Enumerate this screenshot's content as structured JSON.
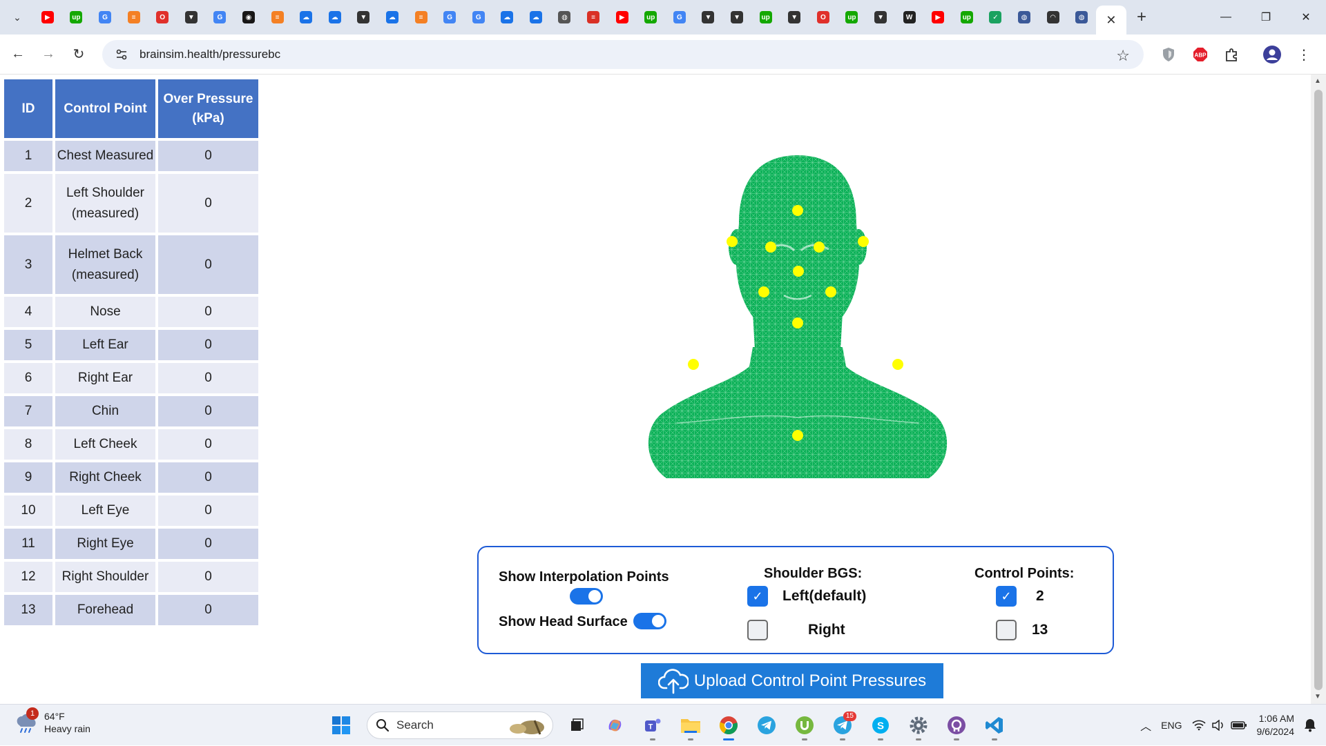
{
  "browser": {
    "tabs": [
      {
        "icon": "youtube-icon",
        "color": "#ff0000"
      },
      {
        "icon": "upwork-icon",
        "color": "#14a800"
      },
      {
        "icon": "google-icon",
        "color": "#4285f4"
      },
      {
        "icon": "stackoverflow-icon",
        "color": "#f48024"
      },
      {
        "icon": "opera-icon",
        "color": "#e0302b"
      },
      {
        "icon": "vercel-icon",
        "color": "#333333"
      },
      {
        "icon": "google-icon",
        "color": "#4285f4"
      },
      {
        "icon": "github-icon",
        "color": "#181717"
      },
      {
        "icon": "stackoverflow-icon",
        "color": "#f48024"
      },
      {
        "icon": "cloud-icon",
        "color": "#1a73e8"
      },
      {
        "icon": "cloud-icon",
        "color": "#1a73e8"
      },
      {
        "icon": "vercel-icon",
        "color": "#333333"
      },
      {
        "icon": "cloud-icon",
        "color": "#1a73e8"
      },
      {
        "icon": "stackoverflow-icon",
        "color": "#f48024"
      },
      {
        "icon": "google-icon",
        "color": "#4285f4"
      },
      {
        "icon": "google-icon",
        "color": "#4285f4"
      },
      {
        "icon": "cloud-icon",
        "color": "#1a73e8"
      },
      {
        "icon": "cloud-icon",
        "color": "#1a73e8"
      },
      {
        "icon": "globe-icon",
        "color": "#555555"
      },
      {
        "icon": "webpage-icon",
        "color": "#d93025"
      },
      {
        "icon": "youtube-icon",
        "color": "#ff0000"
      },
      {
        "icon": "upwork-icon",
        "color": "#14a800"
      },
      {
        "icon": "google-icon",
        "color": "#4285f4"
      },
      {
        "icon": "vercel-icon",
        "color": "#333333"
      },
      {
        "icon": "vercel-icon",
        "color": "#333333"
      },
      {
        "icon": "upwork-icon",
        "color": "#14a800"
      },
      {
        "icon": "vercel-icon",
        "color": "#333333"
      },
      {
        "icon": "opera-icon",
        "color": "#e0302b"
      },
      {
        "icon": "upwork-icon",
        "color": "#14a800"
      },
      {
        "icon": "vercel-icon",
        "color": "#333333"
      },
      {
        "icon": "wikipedia-icon",
        "color": "#222222"
      },
      {
        "icon": "youtube-icon",
        "color": "#ff0000"
      },
      {
        "icon": "upwork-icon",
        "color": "#14a800"
      },
      {
        "icon": "check-icon",
        "color": "#1aa260"
      },
      {
        "icon": "globe-icon",
        "color": "#3b5998"
      },
      {
        "icon": "eye-icon",
        "color": "#333333"
      },
      {
        "icon": "globe-icon",
        "color": "#3b5998"
      }
    ],
    "active_tab_close": "✕",
    "new_tab": "+",
    "url": "brainsim.health/pressurebc",
    "accent": "#1a73e8"
  },
  "table": {
    "headers": {
      "id": "ID",
      "control_point": "Control Point",
      "over_pressure": "Over Pressure (kPa)"
    },
    "rows": [
      {
        "id": "1",
        "name": "Chest Measured",
        "value": "0"
      },
      {
        "id": "2",
        "name": "Left Shoulder (measured)",
        "value": "0"
      },
      {
        "id": "3",
        "name": "Helmet Back (measured)",
        "value": "0"
      },
      {
        "id": "4",
        "name": "Nose",
        "value": "0"
      },
      {
        "id": "5",
        "name": "Left Ear",
        "value": "0"
      },
      {
        "id": "6",
        "name": "Right Ear",
        "value": "0"
      },
      {
        "id": "7",
        "name": "Chin",
        "value": "0"
      },
      {
        "id": "8",
        "name": "Left Cheek",
        "value": "0"
      },
      {
        "id": "9",
        "name": "Right Cheek",
        "value": "0"
      },
      {
        "id": "10",
        "name": "Left Eye",
        "value": "0"
      },
      {
        "id": "11",
        "name": "Right Eye",
        "value": "0"
      },
      {
        "id": "12",
        "name": "Right Shoulder",
        "value": "0"
      },
      {
        "id": "13",
        "name": "Forehead",
        "value": "0"
      }
    ],
    "header_color": "#4472c4"
  },
  "viewer": {
    "surface_color": "#0cb158",
    "marker_color": "#ffff00"
  },
  "controls": {
    "show_interpolation_label": "Show Interpolation Points",
    "show_interpolation_on": true,
    "show_head_surface_label": "Show Head Surface",
    "show_head_surface_on": true,
    "shoulder_bgs_title": "Shoulder BGS:",
    "shoulder_options": [
      {
        "label": "Left(default)",
        "checked": true
      },
      {
        "label": "Right",
        "checked": false
      }
    ],
    "control_points_title": "Control Points:",
    "control_point_options": [
      {
        "label": "2",
        "checked": true
      },
      {
        "label": "13",
        "checked": false
      }
    ]
  },
  "upload_button": {
    "label": "Upload Control Point Pressures",
    "color": "#1e7bd8"
  },
  "taskbar": {
    "weather_temp": "64°F",
    "weather_desc": "Heavy rain",
    "weather_badge": "1",
    "search_label": "Search",
    "telegram_badge": "15",
    "language": "ENG",
    "time": "1:06 AM",
    "date": "9/6/2024"
  }
}
